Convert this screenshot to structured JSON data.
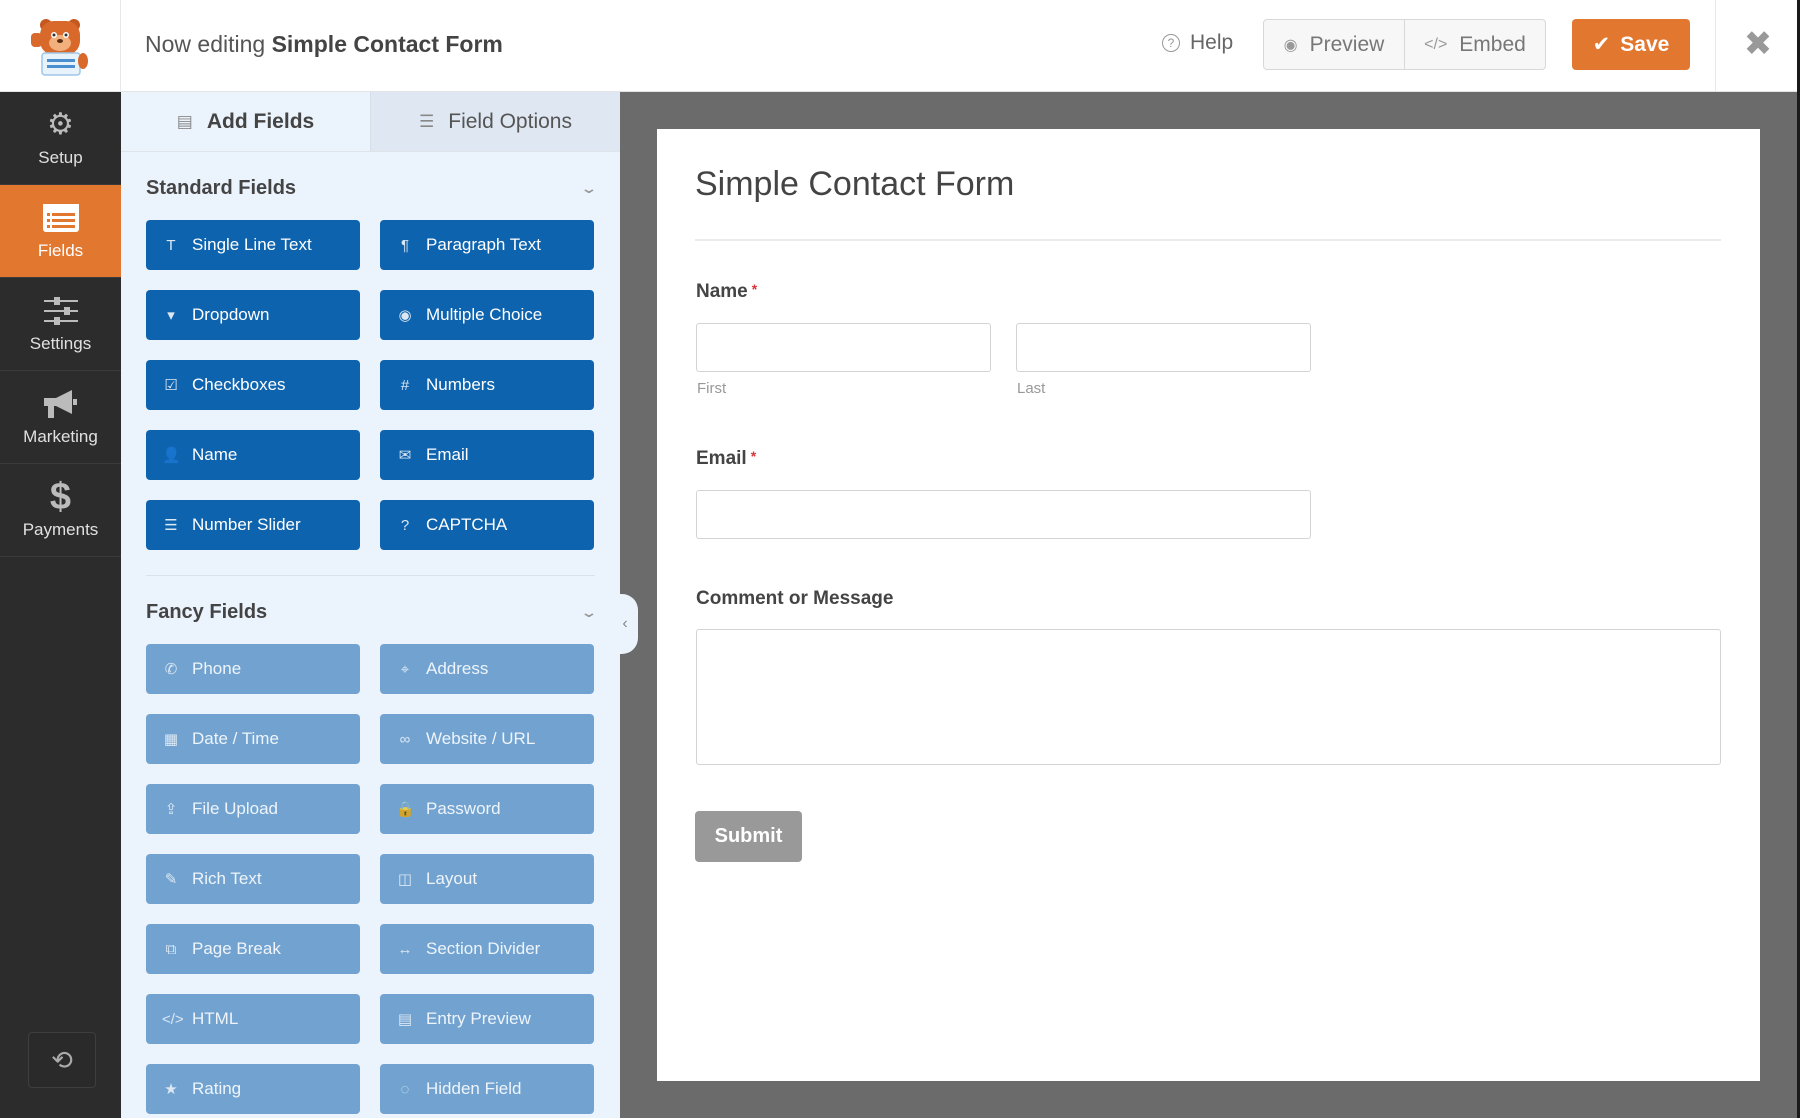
{
  "header": {
    "title_prefix": "Now editing",
    "form_name": "Simple Contact Form",
    "help_label": "Help",
    "preview_label": "Preview",
    "embed_label": "Embed",
    "save_label": "Save",
    "accent_color": "#e27730"
  },
  "sidebar": {
    "items": [
      {
        "label": "Setup",
        "icon": "gear-icon"
      },
      {
        "label": "Fields",
        "icon": "fields-icon",
        "active": true
      },
      {
        "label": "Settings",
        "icon": "sliders-icon"
      },
      {
        "label": "Marketing",
        "icon": "megaphone-icon"
      },
      {
        "label": "Payments",
        "icon": "dollar-icon"
      }
    ],
    "revisions_icon": "history-icon"
  },
  "panel": {
    "tabs": [
      {
        "label": "Add Fields",
        "active": true
      },
      {
        "label": "Field Options",
        "active": false
      }
    ],
    "standard": {
      "title": "Standard Fields",
      "fields": [
        {
          "label": "Single Line Text",
          "icon": "T"
        },
        {
          "label": "Paragraph Text",
          "icon": "¶"
        },
        {
          "label": "Dropdown",
          "icon": "▾"
        },
        {
          "label": "Multiple Choice",
          "icon": "◉"
        },
        {
          "label": "Checkboxes",
          "icon": "☑"
        },
        {
          "label": "Numbers",
          "icon": "#"
        },
        {
          "label": "Name",
          "icon": "👤"
        },
        {
          "label": "Email",
          "icon": "✉"
        },
        {
          "label": "Number Slider",
          "icon": "☰"
        },
        {
          "label": "CAPTCHA",
          "icon": "?"
        }
      ]
    },
    "fancy": {
      "title": "Fancy Fields",
      "fields": [
        {
          "label": "Phone",
          "icon": "✆"
        },
        {
          "label": "Address",
          "icon": "⌖"
        },
        {
          "label": "Date / Time",
          "icon": "▦"
        },
        {
          "label": "Website / URL",
          "icon": "∞"
        },
        {
          "label": "File Upload",
          "icon": "⇪"
        },
        {
          "label": "Password",
          "icon": "🔒"
        },
        {
          "label": "Rich Text",
          "icon": "✎"
        },
        {
          "label": "Layout",
          "icon": "◫"
        },
        {
          "label": "Page Break",
          "icon": "⧉"
        },
        {
          "label": "Section Divider",
          "icon": "↔"
        },
        {
          "label": "HTML",
          "icon": "</>"
        },
        {
          "label": "Entry Preview",
          "icon": "▤"
        },
        {
          "label": "Rating",
          "icon": "★"
        },
        {
          "label": "Hidden Field",
          "icon": "◌"
        }
      ]
    }
  },
  "form": {
    "title": "Simple Contact Form",
    "name_label": "Name",
    "first_sublabel": "First",
    "last_sublabel": "Last",
    "email_label": "Email",
    "message_label": "Comment or Message",
    "required_marker": "*",
    "submit_label": "Submit"
  }
}
